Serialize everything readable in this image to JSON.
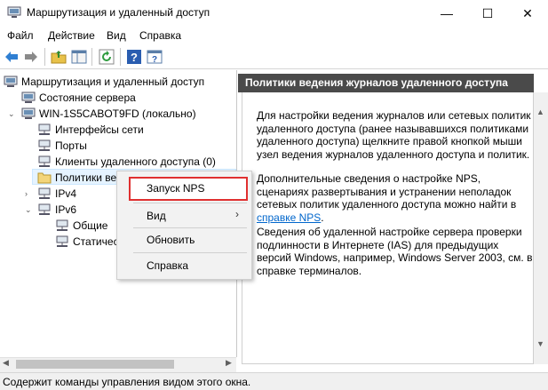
{
  "window": {
    "title": "Маршрутизация и удаленный доступ",
    "min_glyph": "—",
    "max_glyph": "☐",
    "close_glyph": "✕"
  },
  "menu": [
    "Файл",
    "Действие",
    "Вид",
    "Справка"
  ],
  "toolbar": {
    "icons": [
      "back-arrow-icon",
      "forward-arrow-icon",
      "up-folder-icon",
      "show-hide-tree-icon",
      "refresh-icon",
      "help-icon",
      "mmc-help-icon"
    ]
  },
  "tree": {
    "root": "Маршрутизация и удаленный доступ",
    "server_status": "Состояние сервера",
    "server": "WIN-1S5CABOT9FD (локально)",
    "interfaces": "Интерфейсы сети",
    "ports": "Порты",
    "clients": "Клиенты удаленного доступа (0)",
    "policies": "Политики ве",
    "ipv4": "IPv4",
    "ipv6": "IPv6",
    "general": "Общие",
    "static": "Статичес"
  },
  "right": {
    "header": "Политики ведения журналов удаленного доступа",
    "para1": "Для настройки ведения журналов или сетевых политик удаленного доступа (ранее называвшихся политиками удаленного доступа) щелкните правой кнопкой мыши узел ведения журналов удаленного доступа и политик.",
    "para2_text": "Дополнительные сведения о настройке NPS, сценариях развертывания и устранении неполадок сетевых политик удаленного доступа можно найти в ",
    "para2_link": "справке NPS",
    "para2_end": ".",
    "para3": "Сведения об удаленной настройке сервера проверки подлинности в Интернете (IAS) для предыдущих версий Windows, например, Windows Server 2003, см. в справке терминалов."
  },
  "context_menu": {
    "items": [
      "Запуск NPS",
      "Вид",
      "Обновить",
      "Справка"
    ],
    "submenu_arrow": "›"
  },
  "status": "Содержит команды управления видом этого окна.",
  "colors": {
    "header_bg": "#4a4a4a",
    "highlight_border": "#e03030",
    "link": "#0066cc"
  }
}
